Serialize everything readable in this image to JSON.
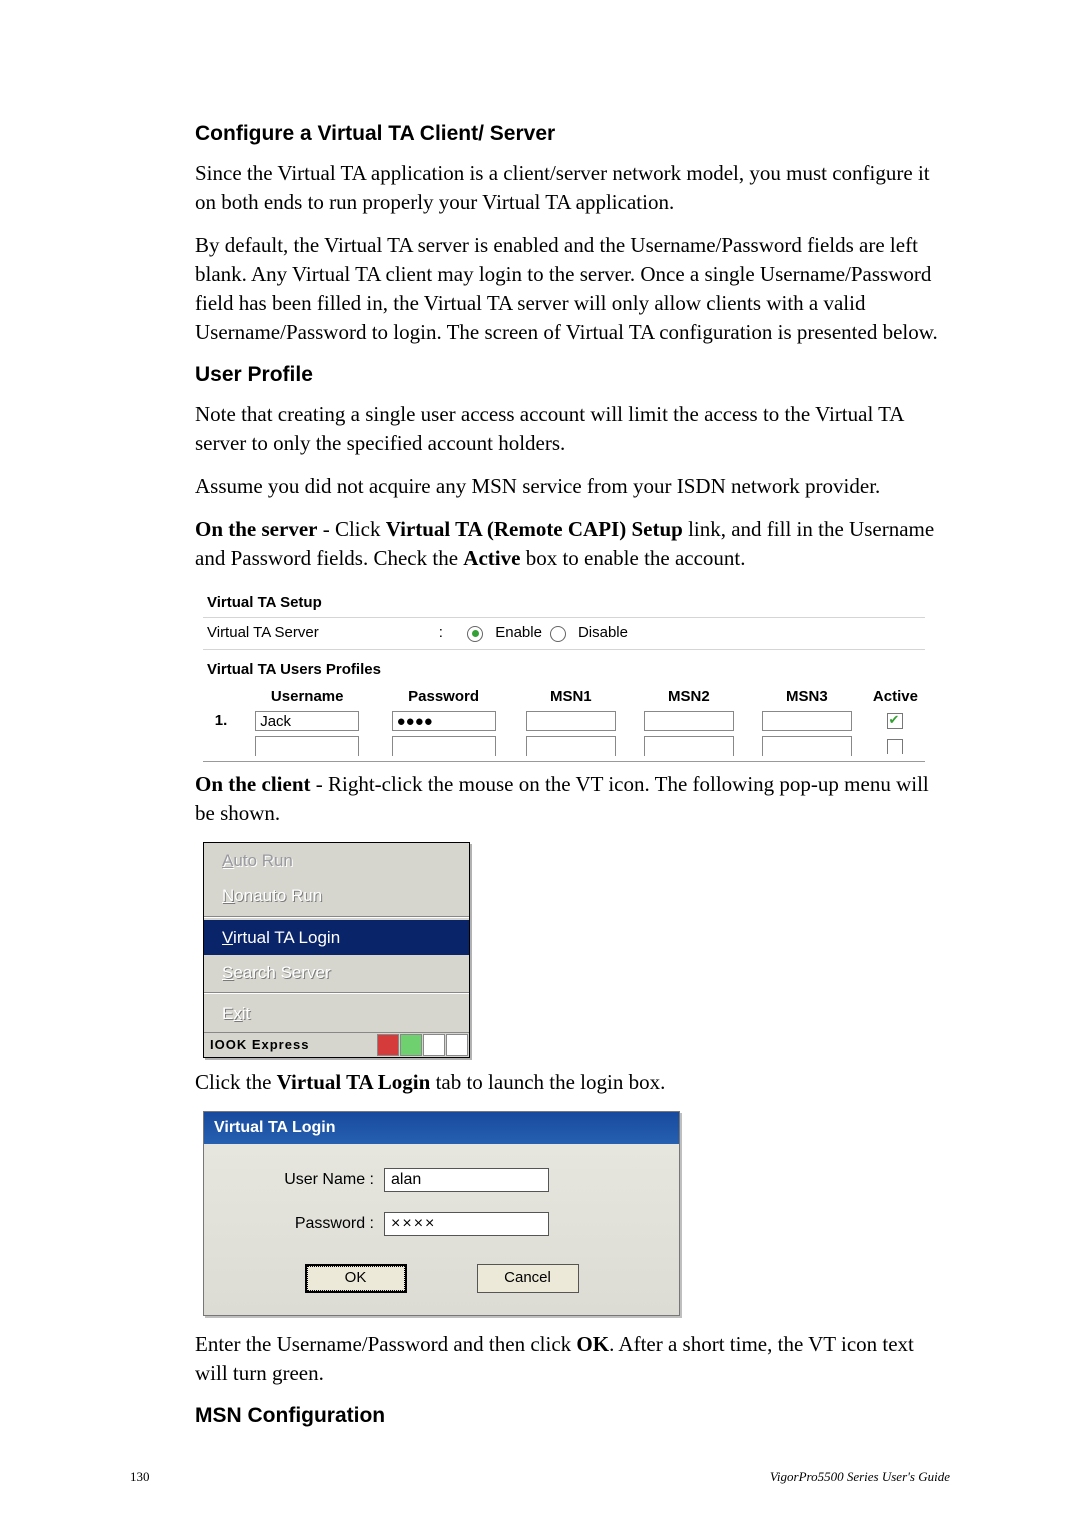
{
  "sec1": {
    "title": "Configure a Virtual TA Client/ Server",
    "p1": "Since the Virtual TA application is a client/server network model, you must configure it on both ends to run properly your Virtual TA application.",
    "p2": "By default, the Virtual TA server is enabled and the Username/Password fields are left blank. Any Virtual TA client may login to the server. Once a single Username/Password field has been filled in, the Virtual TA server will only allow clients with a valid Username/Password to login. The screen of Virtual TA configuration is presented below."
  },
  "sec2": {
    "title": "User Profile",
    "p1": "Note that creating a single user access account will limit the access to the Virtual TA server to only the specified account holders.",
    "p2": "Assume you did not acquire any MSN service from your ISDN network provider.",
    "p3_a": "On the server",
    "p3_b": " - Click ",
    "p3_c": "Virtual TA (Remote CAPI) Setup",
    "p3_d": " link, and fill in the Username and Password fields. Check the ",
    "p3_e": "Active",
    "p3_f": " box to enable the account."
  },
  "setup": {
    "ttl": "Virtual TA Setup",
    "server_label": "Virtual TA Server",
    "sep": ":",
    "enable": "Enable",
    "disable": "Disable",
    "ttl2": "Virtual TA Users Profiles",
    "h": {
      "u": "Username",
      "p": "Password",
      "m1": "MSN1",
      "m2": "MSN2",
      "m3": "MSN3",
      "a": "Active"
    },
    "rownum": "1.",
    "username": "Jack",
    "password": "●●●●"
  },
  "client": {
    "p_a": "On the client",
    "p_b": " - Right-click the mouse on the VT icon. The following pop-up menu will be shown."
  },
  "popup": {
    "auto": "Auto Run",
    "auto_u": "A",
    "nonauto": "onauto Run",
    "nonauto_u": "N",
    "login": "irtual TA Login",
    "login_u": "V",
    "search": "earch Server",
    "search_u": "S",
    "exit": "it",
    "exit_u": "E",
    "exit_mid": "x",
    "bar_text": "IOOK Express"
  },
  "midline": {
    "a": "Click the ",
    "b": "Virtual TA Login",
    "c": " tab to launch the login box."
  },
  "login": {
    "title": "Virtual TA Login",
    "user_lab": "User Name :",
    "pass_lab": "Password :",
    "user_val": "alan",
    "pass_val": "××××",
    "ok": "OK",
    "cancel": "Cancel"
  },
  "after": {
    "a": "Enter the Username/Password and then click ",
    "b": "OK",
    "c": ". After a short time, the VT icon text will turn green."
  },
  "sec3": {
    "title": "MSN Configuration"
  },
  "footer": {
    "page": "130",
    "guide": "VigorPro5500 Series User's Guide"
  }
}
